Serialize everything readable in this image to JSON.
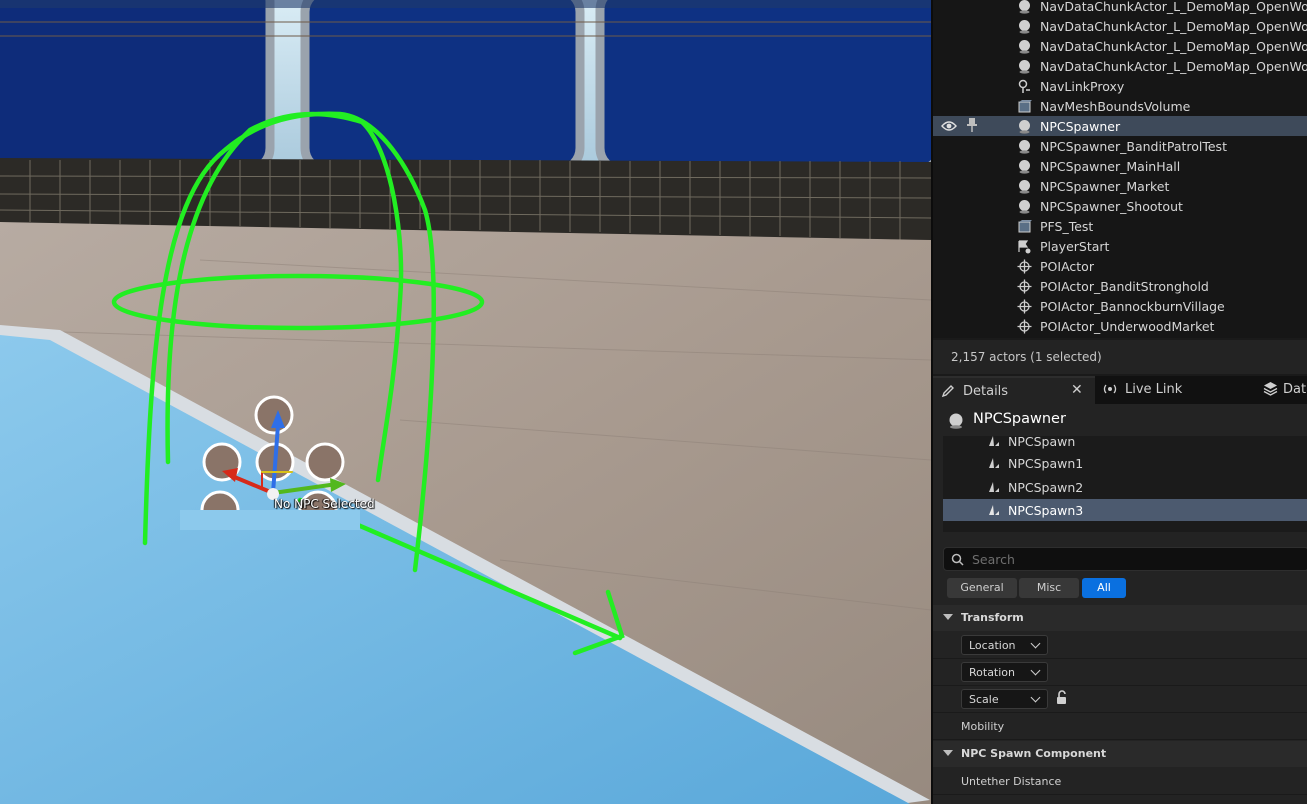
{
  "viewport": {
    "npc_label": "No NPC Selected"
  },
  "outliner": {
    "items": [
      {
        "label": "NavDataChunkActor_L_DemoMap_OpenWorld_",
        "icon": "actor-sphere-icon"
      },
      {
        "label": "NavDataChunkActor_L_DemoMap_OpenWorld_",
        "icon": "actor-sphere-icon"
      },
      {
        "label": "NavDataChunkActor_L_DemoMap_OpenWorld_",
        "icon": "actor-sphere-icon"
      },
      {
        "label": "NavDataChunkActor_L_DemoMap_OpenWorld_",
        "icon": "actor-sphere-icon"
      },
      {
        "label": "NavLinkProxy",
        "icon": "nav-link-icon"
      },
      {
        "label": "NavMeshBoundsVolume",
        "icon": "volume-icon"
      },
      {
        "label": "NPCSpawner",
        "icon": "actor-sphere-icon",
        "selected": true
      },
      {
        "label": "NPCSpawner_BanditPatrolTest",
        "icon": "actor-sphere-icon"
      },
      {
        "label": "NPCSpawner_MainHall",
        "icon": "actor-sphere-icon"
      },
      {
        "label": "NPCSpawner_Market",
        "icon": "actor-sphere-icon"
      },
      {
        "label": "NPCSpawner_Shootout",
        "icon": "actor-sphere-icon"
      },
      {
        "label": "PFS_Test",
        "icon": "volume-icon"
      },
      {
        "label": "PlayerStart",
        "icon": "player-start-icon"
      },
      {
        "label": "POIActor",
        "icon": "crosshair-icon"
      },
      {
        "label": "POIActor_BanditStronghold",
        "icon": "crosshair-icon"
      },
      {
        "label": "POIActor_BannockburnVillage",
        "icon": "crosshair-icon"
      },
      {
        "label": "POIActor_UnderwoodMarket",
        "icon": "crosshair-icon"
      }
    ],
    "actor_count": "2,157 actors (1 selected)"
  },
  "tabs": {
    "details": "Details",
    "live_link": "Live Link",
    "data": "Data"
  },
  "details": {
    "title": "NPCSpawner",
    "components": [
      "NPCSpawn",
      "NPCSpawn1",
      "NPCSpawn2",
      "NPCSpawn3"
    ],
    "search_placeholder": "Search",
    "filters": [
      "General",
      "Misc",
      "All"
    ],
    "transform_header": "Transform",
    "location": "Location",
    "rotation": "Rotation",
    "scale": "Scale",
    "mobility": "Mobility",
    "npc_spawn_header": "NPC Spawn Component",
    "untether_distance": "Untether Distance"
  },
  "colors": {
    "selection": "#3e4a5a",
    "accent": "#0a70e0",
    "gizmo_green": "#22ee22"
  }
}
